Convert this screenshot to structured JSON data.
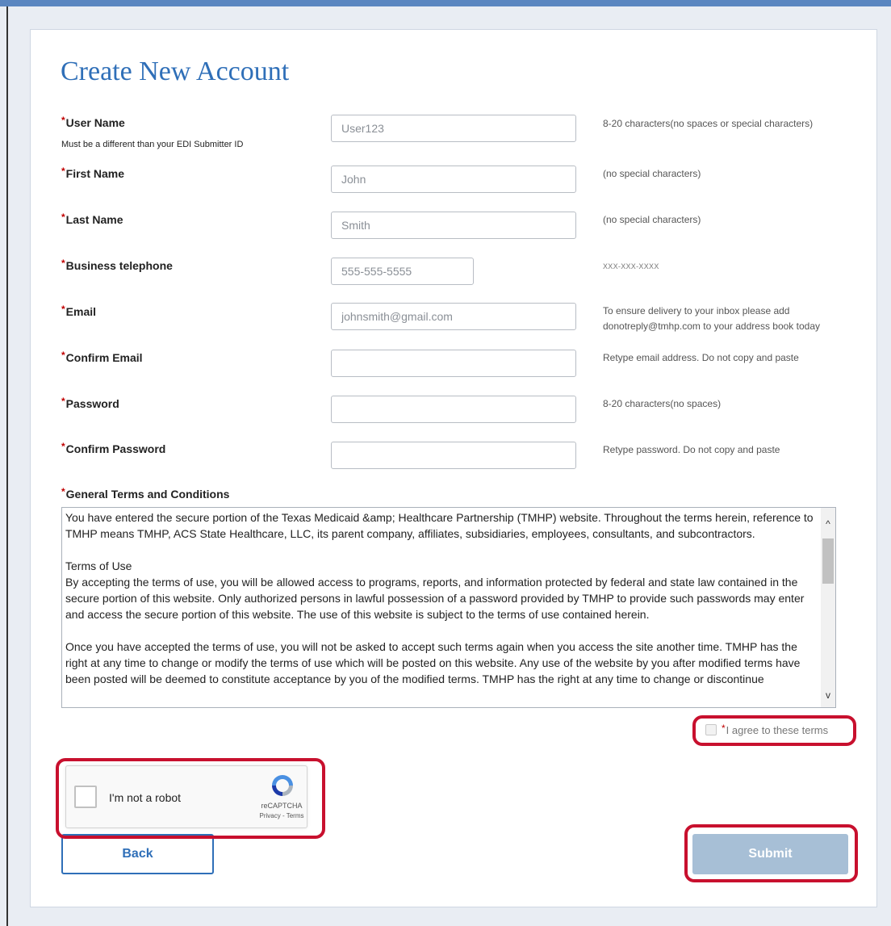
{
  "page": {
    "title": "Create New Account"
  },
  "fields": {
    "username": {
      "label": "User Name",
      "sub_label": "Must be a different than your EDI Submitter ID",
      "placeholder": "User123",
      "hint": "8-20 characters(no spaces or special characters)"
    },
    "first_name": {
      "label": "First Name",
      "placeholder": "John",
      "hint": "(no special characters)"
    },
    "last_name": {
      "label": "Last Name",
      "placeholder": "Smith",
      "hint": "(no special characters)"
    },
    "phone": {
      "label": "Business telephone",
      "placeholder": "555-555-5555",
      "hint": "XXX-XXX-XXXX"
    },
    "email": {
      "label": "Email",
      "placeholder": "johnsmith@gmail.com",
      "hint_line1": "To ensure delivery to your inbox please add",
      "hint_line2": "donotreply@tmhp.com to your address book today"
    },
    "confirm_email": {
      "label": "Confirm Email",
      "placeholder": "",
      "hint": "Retype email address. Do not copy and paste"
    },
    "password": {
      "label": "Password",
      "placeholder": "",
      "hint": "8-20 characters(no spaces)"
    },
    "confirm_password": {
      "label": "Confirm Password",
      "placeholder": "",
      "hint": "Retype password. Do not copy and paste"
    }
  },
  "required_marker": "*",
  "terms": {
    "label": "General Terms and Conditions",
    "paragraph1": "You have entered the secure portion of the Texas Medicaid &amp; Healthcare Partnership (TMHP) website. Throughout the terms herein, reference to TMHP means TMHP, ACS State Healthcare, LLC, its parent company, affiliates, subsidiaries, employees, consultants, and subcontractors.",
    "heading": "Terms of Use",
    "paragraph2": "By accepting the terms of use, you will be allowed access to programs, reports, and information protected by federal and state law contained in the secure portion of this website. Only authorized persons in lawful possession of a password provided by TMHP to provide such passwords may enter and access the secure portion of this website. The use of this website is subject to the terms of use contained herein.",
    "paragraph3": "Once you have accepted the terms of use, you will not be asked to accept such terms again when you access the site another time. TMHP has the right at any time to change or modify the terms of use which will be posted on this website. Any use of the website by you after modified terms have been posted will be deemed to constitute acceptance by you of the modified terms. TMHP has the right at any time to change or discontinue",
    "agree_label": "I agree to these terms",
    "scroll_up": "^",
    "scroll_down": "v"
  },
  "recaptcha": {
    "label": "I'm not a robot",
    "brand": "reCAPTCHA",
    "links": "Privacy - Terms"
  },
  "buttons": {
    "back": "Back",
    "submit": "Submit"
  },
  "colors": {
    "title": "#2f6fb8",
    "required": "#c00000",
    "highlight": "#c8102e",
    "submit_bg": "#a7bfd6",
    "top_bar": "#5a86c0"
  }
}
